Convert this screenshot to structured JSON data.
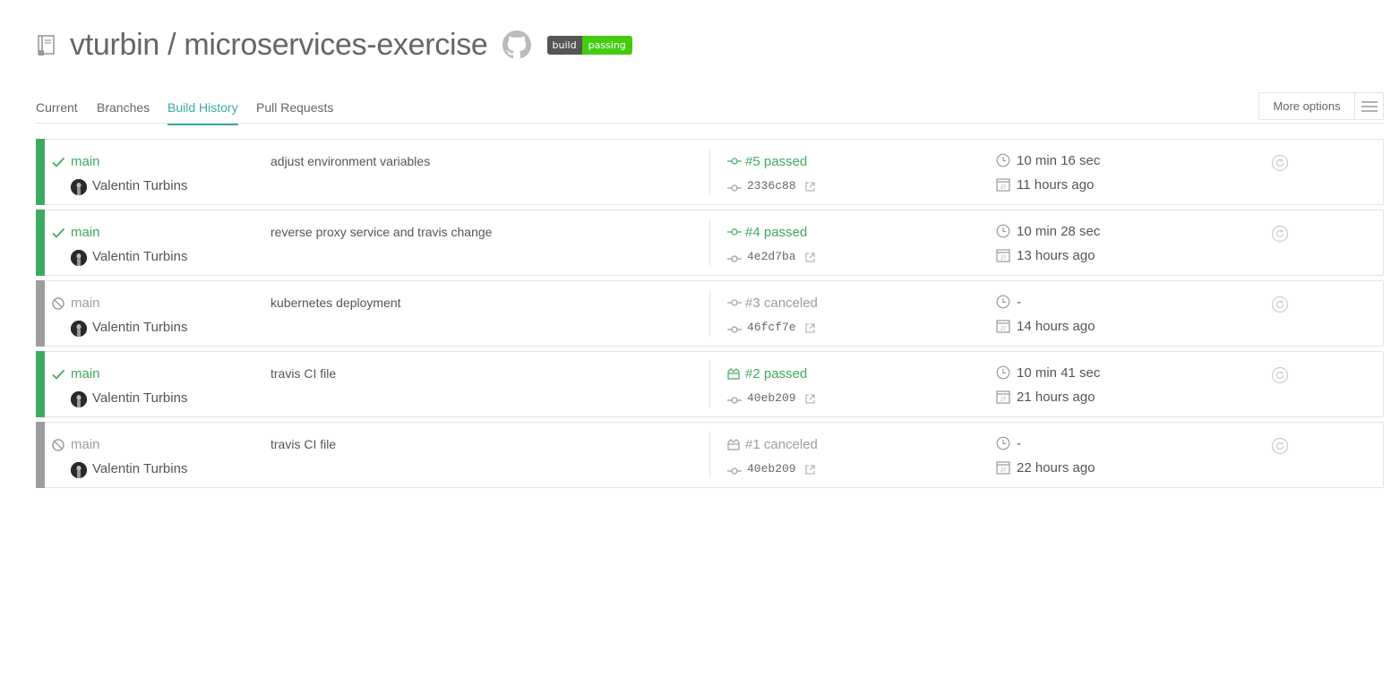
{
  "repo": {
    "title": "vturbin / microservices-exercise",
    "badge_left": "build",
    "badge_right": "passing"
  },
  "tabs": [
    {
      "label": "Current"
    },
    {
      "label": "Branches"
    },
    {
      "label": "Build History"
    },
    {
      "label": "Pull Requests"
    }
  ],
  "more_options": "More options",
  "colors": {
    "passed": "#3eaa60",
    "canceled": "#9d9d9d",
    "accent": "#39aaa4"
  },
  "builds": [
    {
      "status": "passed",
      "branch": "main",
      "author": "Valentin Turbins",
      "message": "adjust environment variables",
      "number": "#5 passed",
      "trigger": "push",
      "sha": "2336c88",
      "duration": "10 min 16 sec",
      "ago": "11 hours ago"
    },
    {
      "status": "passed",
      "branch": "main",
      "author": "Valentin Turbins",
      "message": "reverse proxy service and travis change",
      "number": "#4 passed",
      "trigger": "push",
      "sha": "4e2d7ba",
      "duration": "10 min 28 sec",
      "ago": "13 hours ago"
    },
    {
      "status": "canceled",
      "branch": "main",
      "author": "Valentin Turbins",
      "message": "kubernetes deployment",
      "number": "#3 canceled",
      "trigger": "push",
      "sha": "46fcf7e",
      "duration": "-",
      "ago": "14 hours ago"
    },
    {
      "status": "passed",
      "branch": "main",
      "author": "Valentin Turbins",
      "message": "travis CI file",
      "number": "#2 passed",
      "trigger": "api",
      "sha": "40eb209",
      "duration": "10 min 41 sec",
      "ago": "21 hours ago"
    },
    {
      "status": "canceled",
      "branch": "main",
      "author": "Valentin Turbins",
      "message": "travis CI file",
      "number": "#1 canceled",
      "trigger": "api",
      "sha": "40eb209",
      "duration": "-",
      "ago": "22 hours ago"
    }
  ]
}
